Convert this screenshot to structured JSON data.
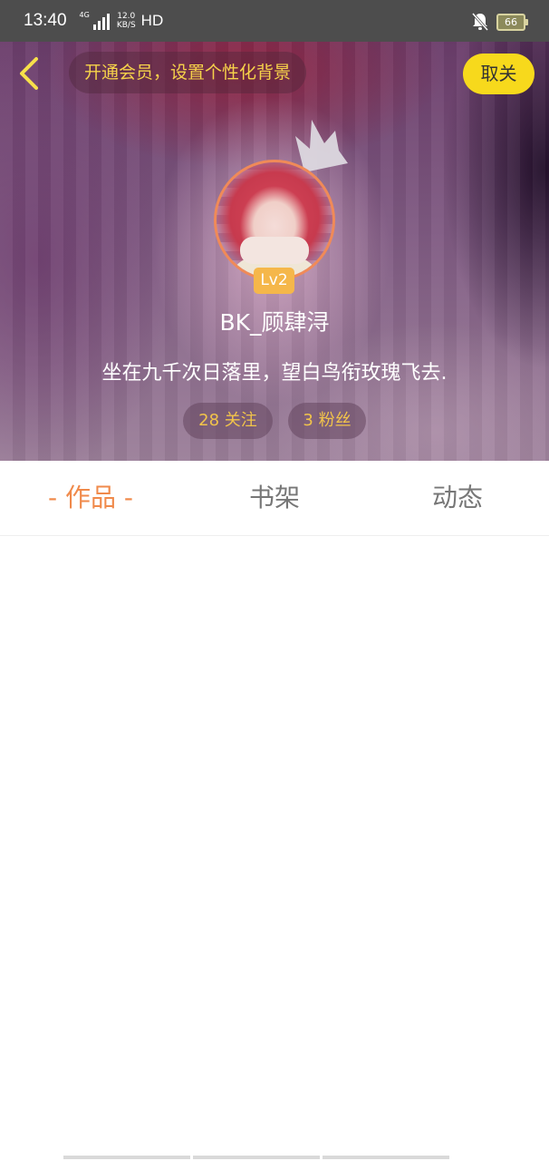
{
  "status_bar": {
    "time": "13:40",
    "network": "4G",
    "speed_value": "12.0",
    "speed_unit": "KB/S",
    "hd": "HD",
    "battery": "66",
    "icons": [
      "signal-icon",
      "bell-off-icon",
      "battery-icon"
    ]
  },
  "header": {
    "promo_text": "开通会员，设置个性化背景",
    "cancel_label": "取关",
    "level": "Lv2",
    "username": "BK_顾肆浔",
    "bio": "坐在九千次日落里，望白鸟衔玫瑰飞去.",
    "following": "28 关注",
    "fans": "3 粉丝"
  },
  "tabs": [
    {
      "label": "作品",
      "active": true
    },
    {
      "label": "书架",
      "active": false
    },
    {
      "label": "动态",
      "active": false
    }
  ],
  "colors": {
    "accent_orange": "#f08a4b",
    "accent_yellow": "#f7d91c",
    "promo_text": "#f7d34a",
    "status_bar": "#4d4d4d"
  }
}
